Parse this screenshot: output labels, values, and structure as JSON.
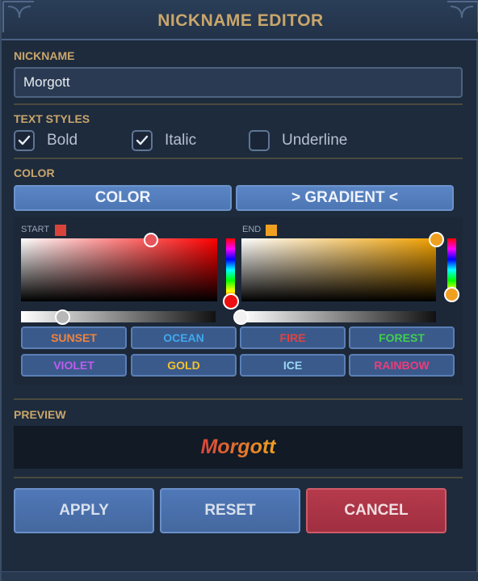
{
  "window": {
    "title": "NICKNAME EDITOR"
  },
  "nickname": {
    "label": "NICKNAME",
    "value": "Morgott"
  },
  "text_styles": {
    "label": "TEXT STYLES",
    "options": [
      {
        "label": "Bold",
        "checked": true
      },
      {
        "label": "Italic",
        "checked": true
      },
      {
        "label": "Underline",
        "checked": false
      }
    ]
  },
  "color": {
    "label": "COLOR",
    "mode_solid_label": "COLOR",
    "mode_gradient_label": "> GRADIENT <",
    "start": {
      "label": "START",
      "swatch_color": "#d9443a"
    },
    "end": {
      "label": "END",
      "swatch_color": "#f0a020"
    },
    "presets": [
      {
        "label": "SUNSET",
        "color": "#f0843c"
      },
      {
        "label": "OCEAN",
        "color": "#3fa9ee"
      },
      {
        "label": "FIRE",
        "color": "#e8403c"
      },
      {
        "label": "FOREST",
        "color": "#3fd14c"
      },
      {
        "label": "VIOLET",
        "color": "#c05cf0"
      },
      {
        "label": "GOLD",
        "color": "#f2c22c"
      },
      {
        "label": "ICE",
        "color": "#9ad8f2"
      },
      {
        "label": "RAINBOW",
        "color": "#ee3c7a"
      }
    ]
  },
  "preview": {
    "label": "PREVIEW",
    "text": "Morgott"
  },
  "actions": {
    "apply": "APPLY",
    "reset": "RESET",
    "cancel": "CANCEL"
  },
  "colors": {
    "accent_gold": "#c9a66b",
    "button_blue": "#4d76b4",
    "button_red": "#a02f41"
  }
}
